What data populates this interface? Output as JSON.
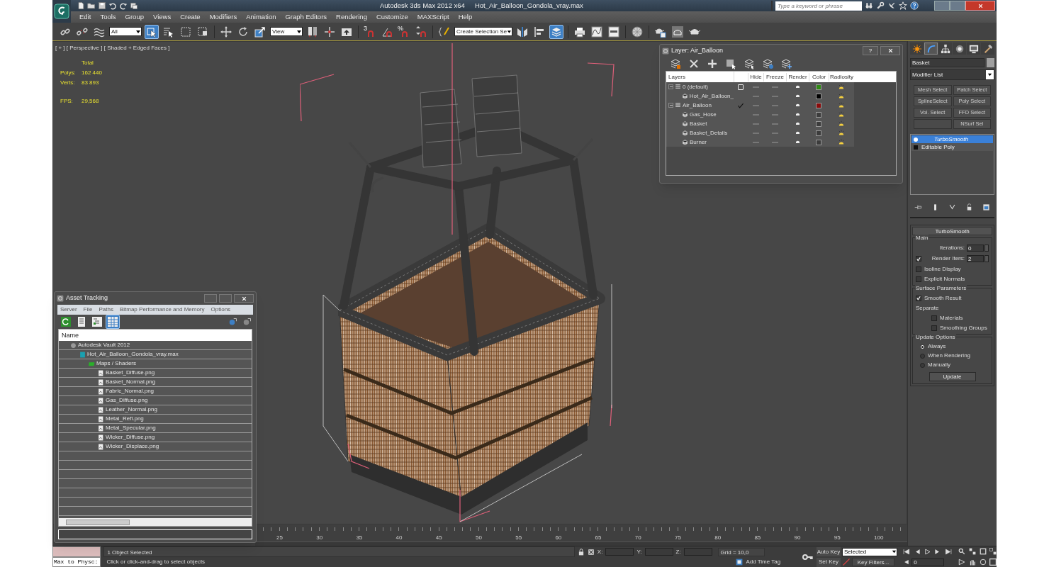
{
  "title_bar": {
    "quick_access": [
      {
        "kind": "new"
      },
      {
        "kind": "open"
      },
      {
        "kind": "save"
      },
      {
        "kind": "undo"
      },
      {
        "kind": "redo"
      },
      {
        "kind": "project"
      }
    ],
    "app_title": "Autodesk 3ds Max  2012 x64",
    "file_name": "Hot_Air_Balloon_Gondola_vray.max",
    "search": {
      "placeholder": "Type a keyword or phrase"
    },
    "tools": [
      {
        "kind": "binoculars"
      },
      {
        "kind": "wrench"
      },
      {
        "kind": "satellite"
      },
      {
        "kind": "star"
      },
      {
        "kind": "help"
      }
    ]
  },
  "menu": [
    "Edit",
    "Tools",
    "Group",
    "Views",
    "Create",
    "Modifiers",
    "Animation",
    "Graph Editors",
    "Rendering",
    "Customize",
    "MAXScript",
    "Help"
  ],
  "toolbar": {
    "groups": [
      [
        {
          "kind": "link",
          "on": false
        },
        {
          "kind": "unlink",
          "on": false
        },
        {
          "kind": "wave",
          "on": false
        },
        {
          "kind": "dropdown",
          "value": "All"
        },
        {
          "kind": "cursor",
          "on": true
        },
        {
          "kind": "list-cursor",
          "on": false
        },
        {
          "kind": "rect-select",
          "on": false
        },
        {
          "kind": "crossing",
          "on": false
        }
      ],
      [
        {
          "kind": "move",
          "on": false
        },
        {
          "kind": "rotate",
          "on": false
        },
        {
          "kind": "scale",
          "on": false
        },
        {
          "kind": "dropdown",
          "value": "View"
        },
        {
          "kind": "pivot",
          "on": false
        },
        {
          "kind": "crosshair",
          "on": false
        },
        {
          "kind": "keyboard",
          "on": false
        }
      ],
      [
        {
          "kind": "snap",
          "label": "3",
          "on": false
        },
        {
          "kind": "angle-snap",
          "on": false
        },
        {
          "kind": "percent-snap",
          "label": "%",
          "on": false
        },
        {
          "kind": "spinner-snap",
          "on": false
        }
      ],
      [
        {
          "kind": "braces",
          "on": false
        },
        {
          "kind": "dropdown",
          "value": "Create Selection Se"
        },
        {
          "kind": "mirror",
          "on": false
        },
        {
          "kind": "align",
          "on": false
        },
        {
          "kind": "layers",
          "on": true
        }
      ],
      [
        {
          "kind": "printer",
          "on": false
        },
        {
          "kind": "curve",
          "on": false
        },
        {
          "kind": "schematic",
          "on": false
        }
      ],
      [
        {
          "kind": "material",
          "on": false
        }
      ],
      [
        {
          "kind": "teapot-doc",
          "on": false
        },
        {
          "kind": "teapot-frame",
          "on": false
        },
        {
          "kind": "teapot",
          "on": false
        }
      ]
    ]
  },
  "viewport": {
    "label": "[ + ] [ Perspective ] [ Shaded + Edged Faces ]",
    "stats": {
      "heading": "Total",
      "rows": [
        {
          "label": "Polys:",
          "value": "162 440"
        },
        {
          "label": "Verts:",
          "value": "83 893"
        }
      ]
    },
    "fps": {
      "label": "FPS:",
      "value": "29,568"
    }
  },
  "layer_dialog": {
    "title": "Layer: Air_Balloon",
    "help": "?",
    "tools": [
      {
        "kind": "new-layer"
      },
      {
        "kind": "delete"
      },
      {
        "kind": "add"
      },
      {
        "kind": "select-objects"
      },
      {
        "kind": "highlight"
      },
      {
        "kind": "hide-all"
      },
      {
        "kind": "freeze-all"
      }
    ],
    "columns": [
      "Layers",
      "Hide",
      "Freeze",
      "Render",
      "Color",
      "Radiosity"
    ],
    "layers": [
      {
        "name": "0 (default)",
        "expanded": true,
        "current": false,
        "hidden": false,
        "frozen": false,
        "color": "#2f8a14",
        "children": [
          {
            "name": "Hot_Air_Balloon_",
            "hidden": false,
            "frozen": false,
            "color": "#000000"
          }
        ]
      },
      {
        "name": "Air_Balloon",
        "expanded": true,
        "current": true,
        "hidden": false,
        "frozen": false,
        "color": "#8a0b0b",
        "children": [
          {
            "name": "Gas_Hose",
            "hidden": false,
            "frozen": false,
            "color": "#3c3c3c"
          },
          {
            "name": "Basket",
            "hidden": false,
            "frozen": false,
            "color": "#3c3c3c"
          },
          {
            "name": "Basket_Details",
            "hidden": false,
            "frozen": false,
            "color": "#3c3c3c"
          },
          {
            "name": "Burner",
            "hidden": false,
            "frozen": false,
            "color": "#3c3c3c"
          }
        ]
      }
    ]
  },
  "asset_tracking": {
    "title": "Asset Tracking",
    "menu": [
      "Server",
      "File",
      "Paths",
      "Bitmap Performance and Memory",
      "Options"
    ],
    "tools": [
      {
        "kind": "refresh",
        "on": false
      },
      {
        "kind": "list",
        "on": false
      },
      {
        "kind": "tree",
        "on": false
      },
      {
        "kind": "table",
        "on": true
      }
    ],
    "column": "Name",
    "tree": [
      {
        "kind": "vault",
        "name": "Autodesk Vault 2012",
        "children": [
          {
            "kind": "max_file",
            "name": "Hot_Air_Balloon_Gondola_vray.max",
            "children": [
              {
                "kind": "folder",
                "name": "Maps / Shaders",
                "children": [
                  {
                    "kind": "image",
                    "name": "Basket_Diffuse.png"
                  },
                  {
                    "kind": "image",
                    "name": "Basket_Normal.png"
                  },
                  {
                    "kind": "image",
                    "name": "Fabric_Normal.png"
                  },
                  {
                    "kind": "image",
                    "name": "Gas_Diffuse.png"
                  },
                  {
                    "kind": "image",
                    "name": "Leather_Normal.png"
                  },
                  {
                    "kind": "image",
                    "name": "Metal_Refl.png"
                  },
                  {
                    "kind": "image",
                    "name": "Metal_Specular.png"
                  },
                  {
                    "kind": "image",
                    "name": "Wicker_Diffuse.png"
                  },
                  {
                    "kind": "image",
                    "name": "Wicker_Displace.png"
                  }
                ]
              }
            ]
          }
        ]
      }
    ]
  },
  "command_panel": {
    "tabs": [
      {
        "kind": "create",
        "selected": false
      },
      {
        "kind": "modify",
        "selected": true
      },
      {
        "kind": "hierarchy",
        "selected": false
      },
      {
        "kind": "motion",
        "selected": false
      },
      {
        "kind": "display",
        "selected": false
      },
      {
        "kind": "utilities",
        "selected": false
      }
    ],
    "object_name": "Basket",
    "modifier_list": "Modifier List",
    "modifier_buttons": [
      "Mesh Select",
      "Patch Select",
      "SplineSelect",
      "Poly Select",
      "Vol. Select",
      "FFD Select",
      "NSurf Sel"
    ],
    "stack": [
      {
        "name": "TurboSmooth",
        "selected": true
      },
      {
        "name": "Editable Poly",
        "selected": false
      }
    ],
    "rollout": {
      "title": "TurboSmooth",
      "groups": [
        {
          "title": "Main",
          "controls": [
            {
              "kind": "spinner",
              "label": "Iterations:",
              "value": "0"
            },
            {
              "kind": "check_spinner",
              "label": "Render Iters:",
              "checked": true,
              "value": "2"
            },
            {
              "kind": "checkbox",
              "label": "Isoline Display",
              "checked": false
            },
            {
              "kind": "checkbox",
              "label": "Explicit Normals",
              "checked": false
            }
          ]
        },
        {
          "title": "Surface Parameters",
          "controls": [
            {
              "kind": "checkbox",
              "label": "Smooth Result",
              "checked": true
            },
            {
              "kind": "label",
              "label": "Separate"
            },
            {
              "kind": "sub_checkbox",
              "label": "Materials",
              "checked": false
            },
            {
              "kind": "sub_checkbox",
              "label": "Smoothing Groups",
              "checked": false
            }
          ]
        },
        {
          "title": "Update Options",
          "controls": [
            {
              "kind": "radio",
              "label": "Always",
              "selected": true
            },
            {
              "kind": "radio",
              "label": "When Rendering",
              "selected": false
            },
            {
              "kind": "radio",
              "label": "Manually",
              "selected": false
            },
            {
              "kind": "button",
              "label": "Update"
            }
          ]
        }
      ]
    }
  },
  "timeline": {
    "ticks": [
      "25",
      "30",
      "35",
      "40",
      "45",
      "50",
      "55",
      "60",
      "65",
      "70",
      "75",
      "80",
      "85",
      "90",
      "95",
      "100"
    ]
  },
  "status_bar": {
    "listener": "Max to Physc:",
    "selection": "1 Object Selected",
    "prompt": "Click or click-and-drag to select objects",
    "coords": [
      "X:",
      "Y:",
      "Z:"
    ],
    "grid": "Grid = 10,0",
    "time_tag": "Add Time Tag",
    "auto_key": "Auto Key",
    "key_mode": "Selected",
    "set_key": "Set Key",
    "key_filters": "Key Filters...",
    "frame": "0"
  }
}
